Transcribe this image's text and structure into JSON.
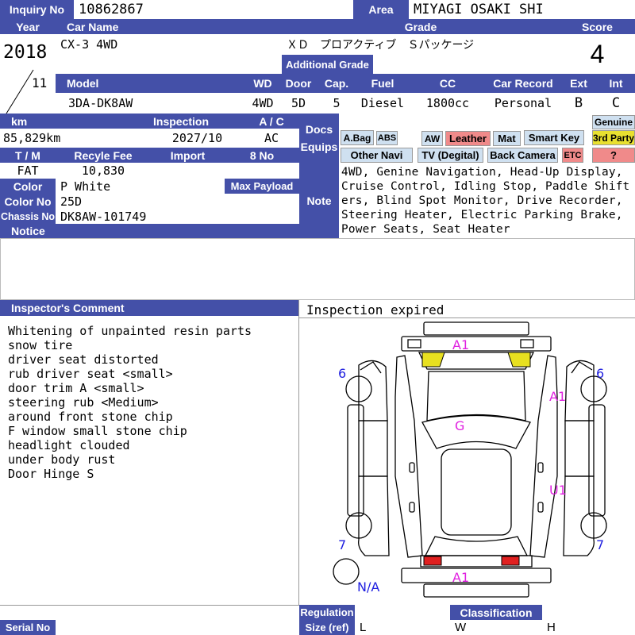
{
  "inquiry": {
    "label": "Inquiry No",
    "value": "10862867"
  },
  "area": {
    "label": "Area",
    "value": "MIYAGI OSAKI SHI"
  },
  "year": {
    "label": "Year",
    "value": "2018",
    "month": "11"
  },
  "car_name": {
    "label": "Car Name",
    "value": "CX-3 4WD"
  },
  "grade": {
    "label": "Grade",
    "value": "ＸＤ　プロアクティブ　Ｓパッケージ",
    "additional_label": "Additional Grade",
    "additional_value": ""
  },
  "score": {
    "label": "Score",
    "value": "4"
  },
  "model": {
    "label": "Model",
    "value": "3DA-DK8AW"
  },
  "wd": {
    "label": "WD",
    "value": "4WD"
  },
  "door": {
    "label": "Door",
    "value": "5D"
  },
  "cap": {
    "label": "Cap.",
    "value": "5"
  },
  "fuel": {
    "label": "Fuel",
    "value": "Diesel"
  },
  "cc": {
    "label": "CC",
    "value": "1800cc"
  },
  "car_record": {
    "label": "Car Record",
    "value": "Personal"
  },
  "ext": {
    "label": "Ext",
    "value": "B"
  },
  "int": {
    "label": "Int",
    "value": "C"
  },
  "km": {
    "label": "km",
    "value": "85,829km"
  },
  "inspection": {
    "label": "Inspection",
    "value": "2027/10"
  },
  "ac": {
    "label": "A / C",
    "value": "AC"
  },
  "docs": {
    "label1": "Docs",
    "label2": "Equips"
  },
  "tm": {
    "label": "T / M",
    "value": "FAT"
  },
  "recycle_fee": {
    "label": "Recyle Fee",
    "value": "10,830"
  },
  "import": {
    "label": "Import",
    "value": ""
  },
  "no8": {
    "label": "8 No",
    "value": ""
  },
  "color": {
    "label": "Color",
    "value": "P White"
  },
  "max_payload": {
    "label": "Max Payload",
    "value": ""
  },
  "color_no": {
    "label": "Color No",
    "value": "25D"
  },
  "chassis_no": {
    "label": "Chassis No",
    "value": "DK8AW-101749"
  },
  "notice": {
    "label": "Notice",
    "value": ""
  },
  "note": {
    "label": "Note",
    "value": "4WD, Genine Navigation, Head-Up Display, Cruise Control, Idling Stop, Paddle Shifters, Blind Spot Monitor, Drive Recorder, Steering Heater, Electric Parking Brake, Power Seats, Seat Heater"
  },
  "equips": {
    "abag": "A.Bag",
    "abs": "ABS",
    "aw": "AW",
    "leather": "Leather",
    "mat": "Mat",
    "smart_key": "Smart Key",
    "genuine": "Genuine",
    "third_party": "3rd Party",
    "other_navi": "Other Navi",
    "tv": "TV (Degital)",
    "back_camera": "Back Camera",
    "etc": "ETC",
    "question": "?",
    "colors": {
      "active": "#cfe0f0",
      "leather": "#f08a8a",
      "third_party": "#e8e030",
      "etc": "#f08a8a",
      "question": "#f08a8a"
    }
  },
  "inspector_comment": {
    "label": "Inspector's Comment",
    "lines": [
      "Whitening of unpainted resin parts",
      "snow tire",
      "driver seat distorted",
      "rub driver seat <small>",
      "door trim A <small>",
      "steering rub <Medium>",
      "around front stone chip",
      "F window small stone chip",
      "headlight clouded",
      "under body rust",
      "Door Hinge S"
    ]
  },
  "inspection_status": "Inspection expired",
  "diagram_marks": {
    "front": "A1",
    "rear": "A1",
    "roof": "G",
    "right_front_door": "A1",
    "right_rear_door": "U1",
    "tire_fl": "6",
    "tire_fr": "6",
    "tire_rl": "7",
    "tire_rr": "7",
    "spare": "N/A",
    "colors": {
      "damage": "#e020e0",
      "tire": "#2020e0",
      "headlight": "#e8e020",
      "taillight": "#e02020"
    }
  },
  "footer": {
    "serial_label": "Serial No",
    "serial_value": "",
    "regulation_label": "Regulation",
    "size_label": "Size (ref)",
    "classification_label": "Classification",
    "size_l": "L",
    "size_w": "W",
    "size_h": "H"
  },
  "theme": {
    "header": "#4450a8"
  }
}
